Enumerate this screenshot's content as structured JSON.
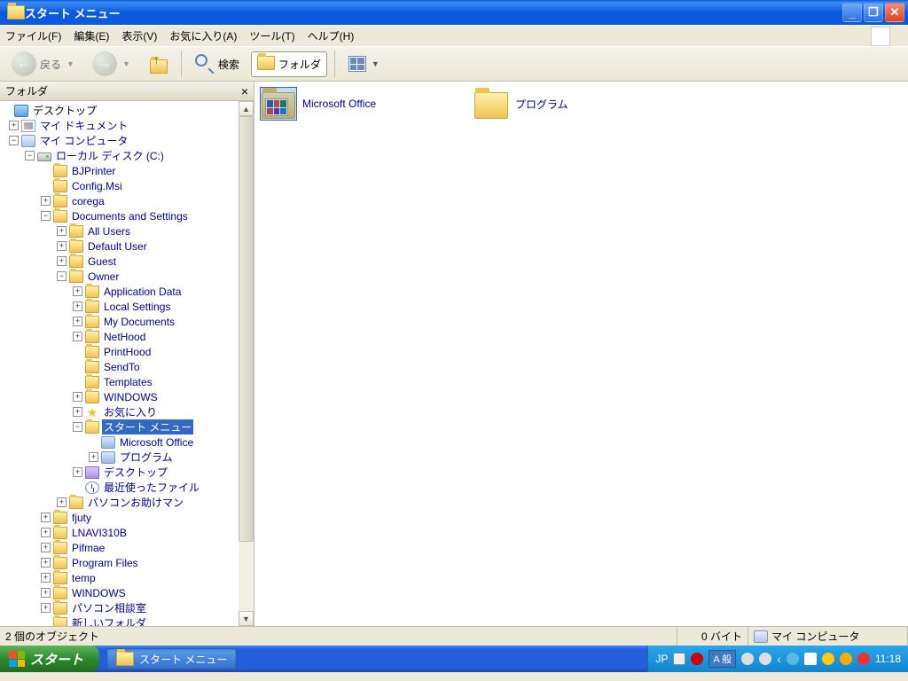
{
  "window": {
    "title": "スタート メニュー",
    "menus": [
      "ファイル(F)",
      "編集(E)",
      "表示(V)",
      "お気に入り(A)",
      "ツール(T)",
      "ヘルプ(H)"
    ],
    "toolbar": {
      "back": "戻る",
      "search": "検索",
      "folders": "フォルダ"
    }
  },
  "folders_pane": {
    "title": "フォルダ"
  },
  "tree": {
    "desktop": "デスクトップ",
    "mydocs": "マイ ドキュメント",
    "mycomp": "マイ コンピュータ",
    "cdrive": "ローカル ディスク (C:)",
    "bjprinter": "BJPrinter",
    "configmsi": "Config.Msi",
    "corega": "corega",
    "docsettings": "Documents and Settings",
    "allusers": "All Users",
    "defaultuser": "Default User",
    "guest": "Guest",
    "owner": "Owner",
    "appdata": "Application Data",
    "localsettings": "Local Settings",
    "mydocuments": "My Documents",
    "nethood": "NetHood",
    "printhood": "PrintHood",
    "sendto": "SendTo",
    "templates": "Templates",
    "windows_u": "WINDOWS",
    "favorites": "お気に入り",
    "startmenu": "スタート メニュー",
    "msoffice": "Microsoft Office",
    "programs": "プログラム",
    "deskfolder": "デスクトップ",
    "recent": "最近使ったファイル",
    "pcotasuke": "パソコンお助けマン",
    "fjuty": "fjuty",
    "lnavi": "LNAVI310B",
    "pifmae": "Pifmae",
    "progfiles": "Program Files",
    "temp": "temp",
    "windows": "WINDOWS",
    "pcsoudan": "パソコン相談室",
    "newfolder": "新しいフォルダ"
  },
  "content": {
    "items": [
      {
        "name": "Microsoft Office",
        "selected": true,
        "type": "msoffice"
      },
      {
        "name": "プログラム",
        "selected": false,
        "type": "folder"
      }
    ]
  },
  "statusbar": {
    "objects": "2 個のオブジェクト",
    "size": "0 バイト",
    "location": "マイ コンピュータ"
  },
  "taskbar": {
    "start": "スタート",
    "task1": "スタート メニュー",
    "lang": "JP",
    "ime": "A 般",
    "clock": "11:18"
  }
}
